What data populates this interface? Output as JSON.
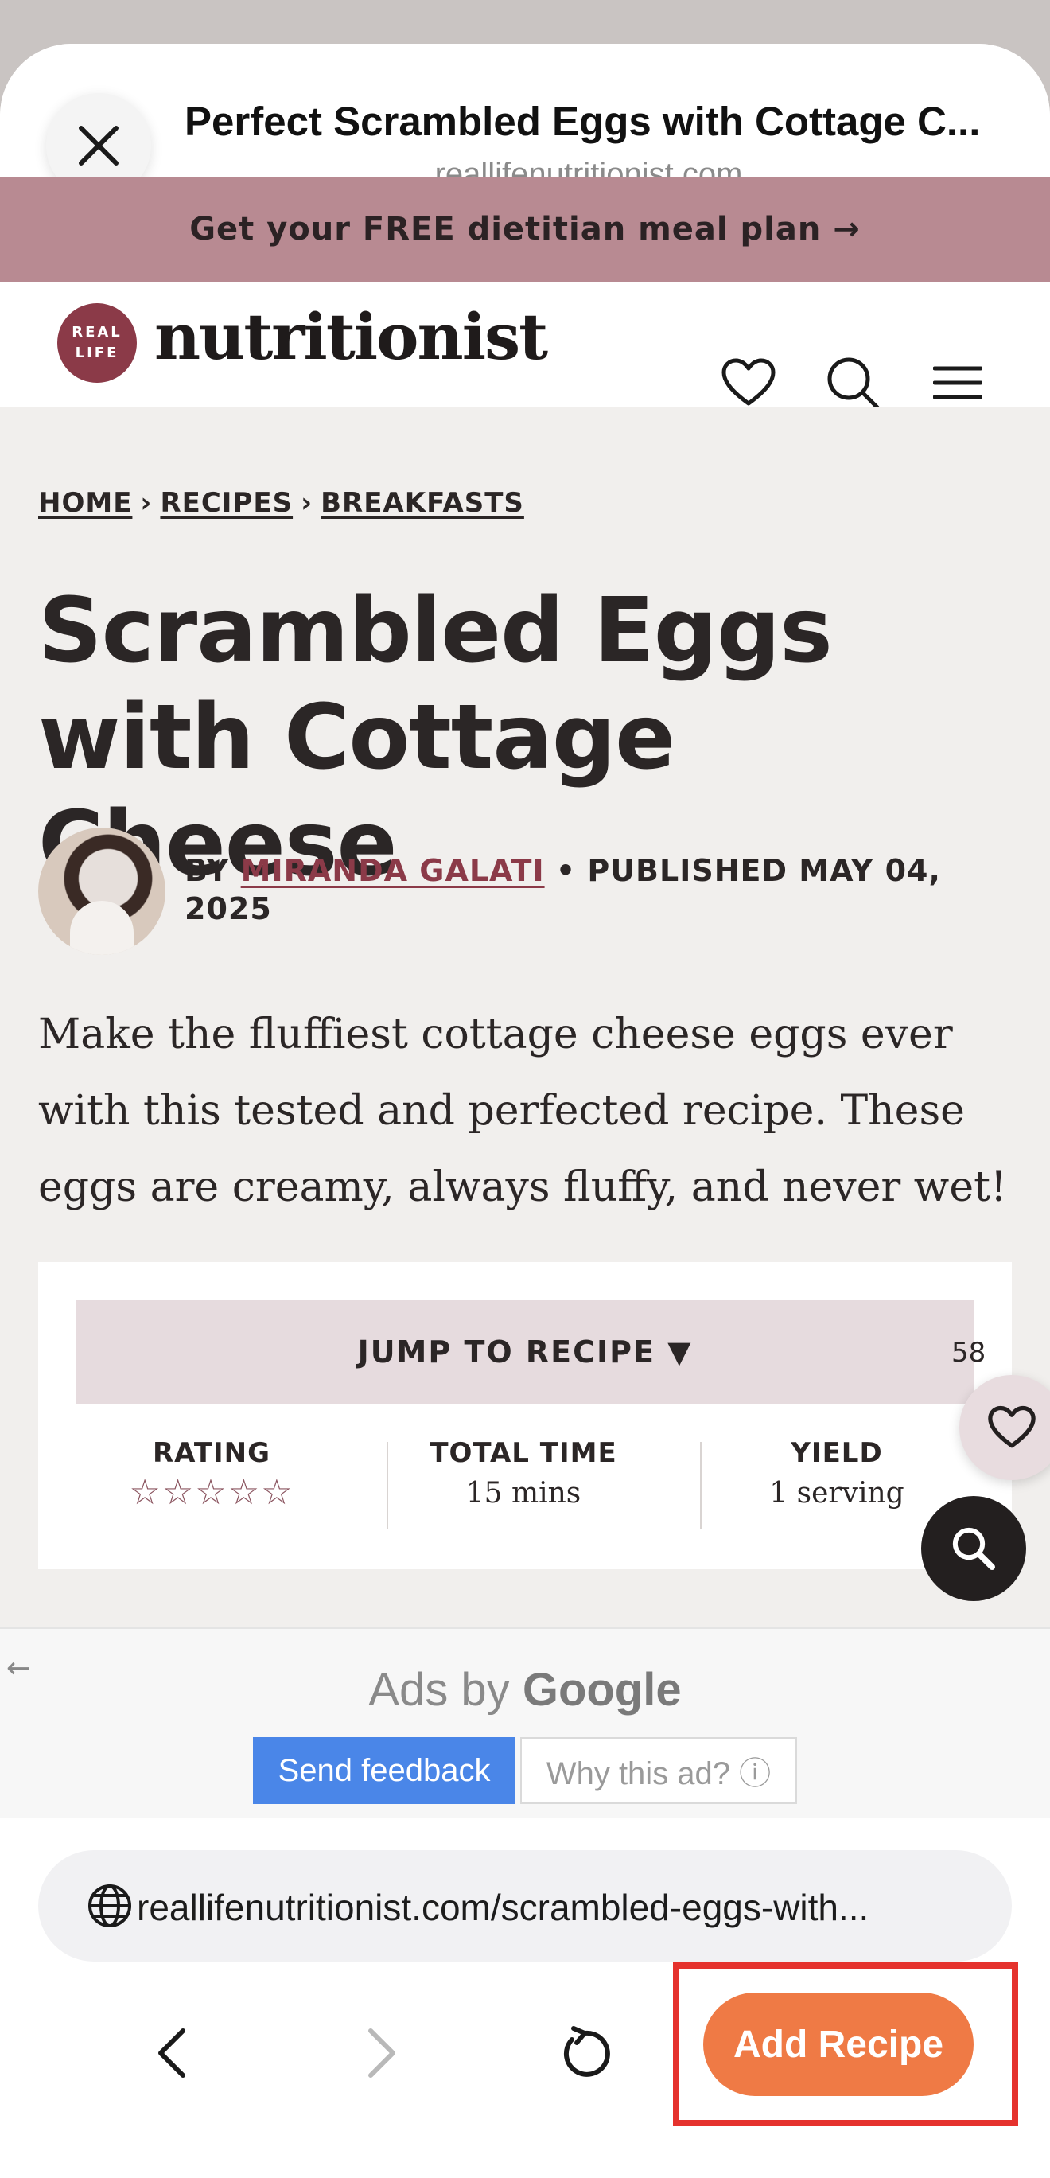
{
  "sheet": {
    "title": "Perfect Scrambled Eggs with Cottage C...",
    "domain": "reallifenutritionist.com"
  },
  "promo": {
    "text": "Get your FREE dietitian meal plan →"
  },
  "site": {
    "logo_badge_line1": "REAL",
    "logo_badge_line2": "LIFE",
    "logo_word": "nutritionist"
  },
  "breadcrumb": {
    "home": "HOME",
    "recipes": "RECIPES",
    "breakfasts": "BREAKFASTS",
    "separator": "›"
  },
  "article": {
    "title": "Scrambled Eggs with Cottage Cheese",
    "by": "BY",
    "author": "MIRANDA GALATI",
    "published": "• PUBLISHED MAY 04, 2025",
    "intro": "Make the fluffiest cottage cheese eggs ever with this tested and perfected recipe. These eggs are creamy, always fluffy, and never wet!"
  },
  "recipe_card": {
    "jump_label": "JUMP TO RECIPE ▼",
    "rating_label": "RATING",
    "rating_stars": "☆☆☆☆☆",
    "total_time_label": "TOTAL TIME",
    "total_time_value": "15 mins",
    "yield_label": "YIELD",
    "yield_value": "1 serving"
  },
  "fab": {
    "favorites_count": "58"
  },
  "ad": {
    "ads_by": "Ads by",
    "google": "Google",
    "send_feedback": "Send feedback",
    "why_this_ad": "Why this ad? ⓘ",
    "back_arrow": "←"
  },
  "browser": {
    "url": "reallifenutritionist.com/scrambled-eggs-with...",
    "add_recipe": "Add Recipe"
  },
  "colors": {
    "promo_bg": "#b88a92",
    "brand": "#8b3a48",
    "accent_button": "#ef7a45",
    "highlight_frame": "#e5322d",
    "feedback_blue": "#4a86e8"
  },
  "icons": [
    "close-icon",
    "heart-icon",
    "search-icon",
    "menu-icon",
    "globe-icon",
    "chevron-left-icon",
    "chevron-right-icon",
    "reload-icon"
  ]
}
